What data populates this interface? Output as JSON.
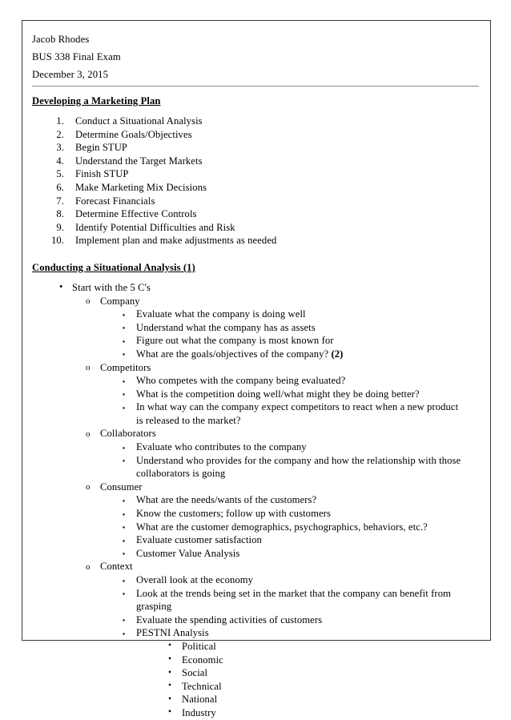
{
  "document": {
    "header": {
      "author": "Jacob Rhodes",
      "course": "BUS 338 Final Exam",
      "date": "December 3, 2015"
    },
    "sections": [
      {
        "heading": "Developing a Marketing Plan",
        "numbered_items": [
          {
            "number": "1.",
            "text": "Conduct a Situational Analysis"
          },
          {
            "number": "2.",
            "text": "Determine Goals/Objectives"
          },
          {
            "number": "3.",
            "text": "Begin STUP"
          },
          {
            "number": "4.",
            "text": "Understand the Target Markets"
          },
          {
            "number": "5.",
            "text": "Finish STUP"
          },
          {
            "number": "6.",
            "text": "Make Marketing Mix Decisions"
          },
          {
            "number": "7.",
            "text": "Forecast Financials"
          },
          {
            "number": "8.",
            "text": "Determine Effective Controls"
          },
          {
            "number": "9.",
            "text": "Identify Potential Difficulties and Risk"
          },
          {
            "number": "10.",
            "text": "Implement plan and make adjustments as needed"
          }
        ]
      },
      {
        "heading": "Conducting a Situational Analysis (1)",
        "bullet": "Start with the 5 C's",
        "groups": [
          {
            "name": "Company",
            "points": [
              "Evaluate what the company is doing well",
              "Understand what the company has as assets",
              "Figure out what the company is most known for",
              "What are the goals/objectives of the company?"
            ],
            "last_point_suffix": "(2)"
          },
          {
            "name": "Competitors",
            "points": [
              "Who competes with the company being evaluated?",
              "What is the competition doing well/what might they be doing better?",
              "In what way can the company expect competitors to react when a new product is released to the market?"
            ]
          },
          {
            "name": "Collaborators",
            "points": [
              "Evaluate who contributes to the company",
              "Understand who provides for the company and how the relationship with those collaborators is going"
            ]
          },
          {
            "name": "Consumer",
            "points": [
              "What are the needs/wants of the customers?",
              "Know the customers; follow up with customers",
              "What are the customer demographics, psychographics, behaviors, etc.?",
              "Evaluate customer satisfaction",
              "Customer Value Analysis"
            ]
          },
          {
            "name": "Context",
            "points": [
              "Overall look at the economy",
              "Look at the trends being set in the market that the company can benefit from grasping",
              "Evaluate the spending activities of customers",
              "PESTNI Analysis"
            ],
            "sub_points": [
              "Political",
              "Economic",
              "Social",
              "Technical",
              "National",
              "Industry"
            ]
          }
        ]
      }
    ],
    "markers": {
      "disc": "•",
      "circle": "o",
      "square": "▪"
    }
  }
}
